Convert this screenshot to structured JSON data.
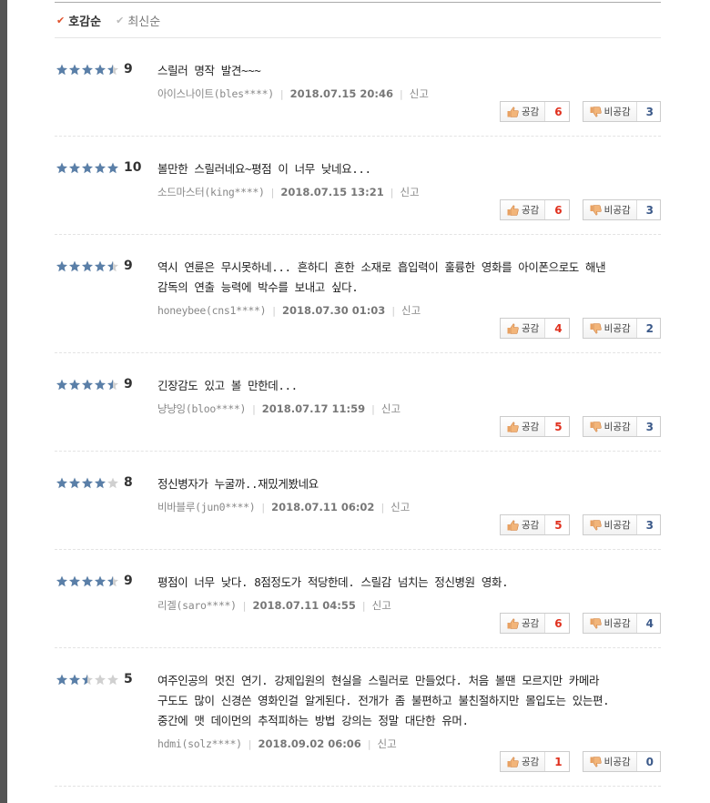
{
  "sort": {
    "options": [
      {
        "label": "호감순",
        "active": true
      },
      {
        "label": "최신순",
        "active": false
      }
    ]
  },
  "vote_labels": {
    "up": "공감",
    "down": "비공감"
  },
  "report_label": "신고",
  "colors": {
    "star_full": "#5a7fa8",
    "star_empty": "#d0d0d0",
    "up_count": "#e0301e",
    "down_count": "#3c5a8a"
  },
  "reviews": [
    {
      "stars": 4.5,
      "score": "9",
      "text": [
        "스릴러 명작 발견~~~"
      ],
      "user": "아이스나이트(bles****)",
      "date": "2018.07.15 20:46",
      "up": "6",
      "down": "3"
    },
    {
      "stars": 5,
      "score": "10",
      "text": [
        "볼만한 스릴러네요~평점 이 너무 낮네요..."
      ],
      "user": "소드마스터(king****)",
      "date": "2018.07.15 13:21",
      "up": "6",
      "down": "3"
    },
    {
      "stars": 4.5,
      "score": "9",
      "text": [
        "역시 연륜은 무시못하네... 흔하디 흔한 소재로 흡입력이 훌륭한 영화를 아이폰으로도 해낸",
        "감독의 연출 능력에 박수를 보내고 싶다."
      ],
      "user": "honeybee(cns1****)",
      "date": "2018.07.30 01:03",
      "up": "4",
      "down": "2"
    },
    {
      "stars": 4.5,
      "score": "9",
      "text": [
        "긴장감도 있고 볼 만한데..."
      ],
      "user": "냥냥잉(bloo****)",
      "date": "2018.07.17 11:59",
      "up": "5",
      "down": "3"
    },
    {
      "stars": 4,
      "score": "8",
      "text": [
        "정신병자가 누굴까..재밌게봤네요"
      ],
      "user": "비바블루(jun0****)",
      "date": "2018.07.11 06:02",
      "up": "5",
      "down": "3"
    },
    {
      "stars": 4.5,
      "score": "9",
      "text": [
        "평점이 너무 낮다. 8점정도가 적당한데. 스릴감 넘치는 정신병원 영화."
      ],
      "user": "리겔(saro****)",
      "date": "2018.07.11 04:55",
      "up": "6",
      "down": "4"
    },
    {
      "stars": 2.5,
      "score": "5",
      "text": [
        "여주인공의 멋진 연기. 강제입원의 현실을 스릴러로 만들었다. 처음 볼땐 모르지만 카메라",
        "구도도 많이 신경쓴 영화인걸 알게된다. 전개가 좀 불편하고 불친절하지만 몰입도는 있는편.",
        "중간에 맷 데이먼의 추적피하는 방법 강의는 정말 대단한 유머."
      ],
      "user": "hdmi(solz****)",
      "date": "2018.09.02 06:06",
      "up": "1",
      "down": "0"
    }
  ]
}
